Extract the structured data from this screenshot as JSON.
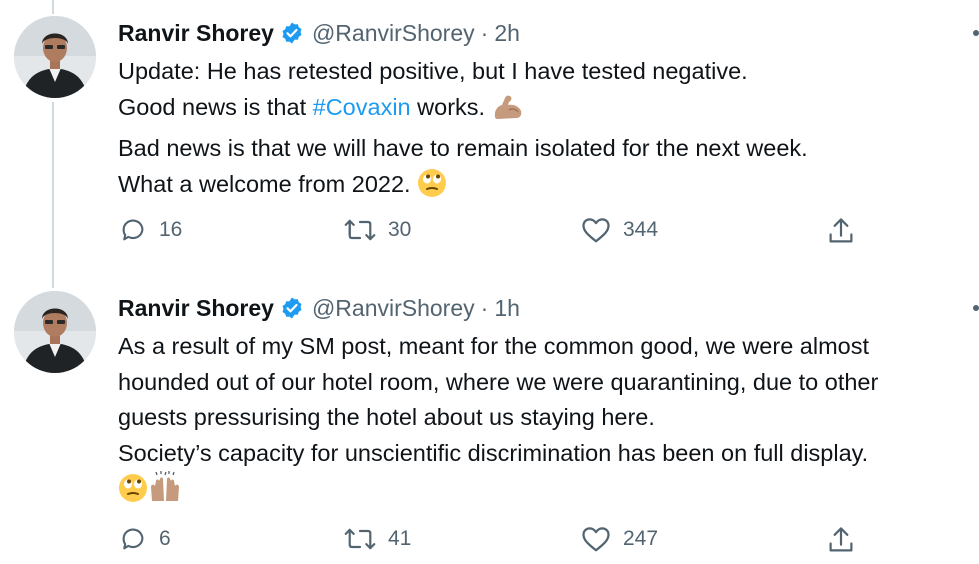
{
  "tweets": [
    {
      "name": "Ranvir Shorey",
      "handle": "@RanvirShorey",
      "separator": "·",
      "time": "2h",
      "body": {
        "line1": "Update: He has retested positive, but I have tested negative.",
        "line2_prefix": "Good news is that ",
        "line2_hashtag": "#Covaxin",
        "line2_suffix": " works.",
        "line3": "Bad news is that we will have to remain isolated for the next week.",
        "line4": "What a welcome from 2022."
      },
      "emojis": [
        "flexed-biceps",
        "face-with-rolling-eyes"
      ],
      "actions": {
        "replies": "16",
        "retweets": "30",
        "likes": "344"
      }
    },
    {
      "name": "Ranvir Shorey",
      "handle": "@RanvirShorey",
      "separator": "·",
      "time": "1h",
      "body": {
        "line1": "As a result of my SM post, meant for the common good, we were almost",
        "line2": "hounded out of our hotel room, where we were quarantining, due to other",
        "line3": "guests pressurising the hotel about us staying here.",
        "line4": "Society’s capacity for unscientific discrimination has been on full display."
      },
      "emojis": [
        "face-with-rolling-eyes",
        "raising-hands"
      ],
      "actions": {
        "replies": "6",
        "retweets": "41",
        "likes": "247"
      }
    }
  ],
  "colors": {
    "text": "#0f1419",
    "secondary": "#536471",
    "accent": "#1d9bf0",
    "thread_line": "#cfd9de"
  }
}
